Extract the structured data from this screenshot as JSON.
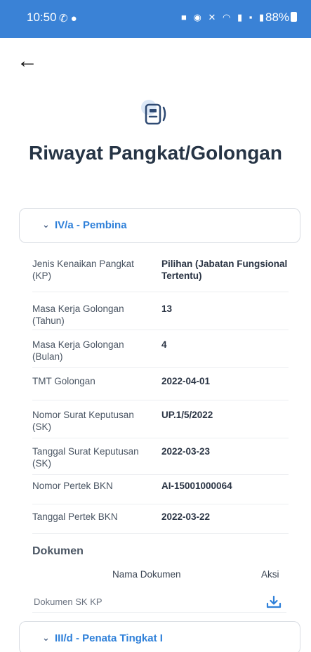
{
  "status_bar": {
    "time": "10:50",
    "battery": "88%",
    "left_icons": [
      "whatsapp-icon",
      "drop-icon"
    ],
    "right_icons": [
      "shield-icon",
      "alarm-icon",
      "mute-icon",
      "wifi-icon",
      "signal-icon",
      "volte-icon",
      "signal-icon-2"
    ]
  },
  "colors": {
    "status_bar": "#3a82d6",
    "accent": "#2f80d9",
    "title": "#263445"
  },
  "page": {
    "title": "Riwayat Pangkat/Golongan",
    "icon": "id-card-icon",
    "back_icon": "arrow-left-icon"
  },
  "accordion_1": {
    "label": "IV/a - Pembina",
    "expanded": true,
    "rows": [
      {
        "label": "Jenis Kenaikan Pangkat (KP)",
        "value": "Pilihan  (Jabatan Fungsional Tertentu)"
      },
      {
        "label": "Masa Kerja Golongan (Tahun)",
        "value": "13"
      },
      {
        "label": "Masa Kerja Golongan (Bulan)",
        "value": "4"
      },
      {
        "label": "TMT Golongan",
        "value": "2022-04-01"
      },
      {
        "label": "Nomor Surat Keputusan (SK)",
        "value": "UP.1/5/2022"
      },
      {
        "label": "Tanggal Surat Keputusan (SK)",
        "value": "2022-03-23"
      },
      {
        "label": "Nomor Pertek BKN",
        "value": "AI-15001000064"
      },
      {
        "label": "Tanggal Pertek BKN",
        "value": "2022-03-22"
      }
    ],
    "documents": {
      "title": "Dokumen",
      "col_name": "Nama Dokumen",
      "col_action": "Aksi",
      "items": [
        {
          "name": "Dokumen SK KP",
          "action_icon": "download-icon"
        }
      ]
    }
  },
  "accordion_2": {
    "label": "III/d - Penata Tingkat I",
    "expanded": false
  }
}
